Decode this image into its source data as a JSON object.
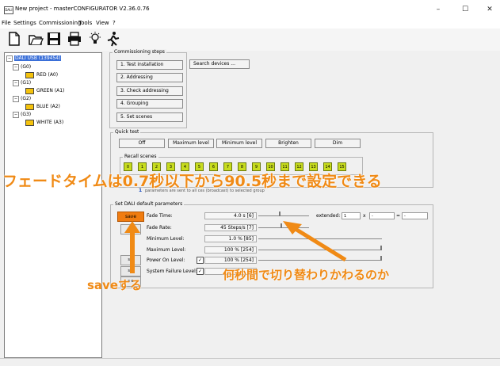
{
  "window": {
    "title": "New project - masterCONFIGURATOR V2.36.0.76",
    "app_icon_text": "DALI",
    "minimize": "–",
    "maximize": "☐",
    "close": "✕"
  },
  "menu": [
    "File",
    "Settings",
    "Commissioning",
    "Tools",
    "View",
    "?"
  ],
  "toolbar_icons": [
    "new-document-icon",
    "open-folder-icon",
    "save-disk-icon",
    "print-icon",
    "lightbulb-icon",
    "running-person-icon"
  ],
  "tree": {
    "root": "DALI USB (139454)",
    "groups": [
      {
        "name": "(G0)",
        "device": "RED (A0)"
      },
      {
        "name": "(G1)",
        "device": "GREEN (A1)"
      },
      {
        "name": "(G2)",
        "device": "BLUE (A2)"
      },
      {
        "name": "(G3)",
        "device": "WHITE (A3)"
      }
    ]
  },
  "commissioning": {
    "title": "Commissioning steps",
    "steps": [
      "1. Test installation",
      "2. Addressing",
      "3. Check addressing",
      "4. Grouping",
      "5. Set scenes"
    ],
    "search": "Search devices ..."
  },
  "quick_test": {
    "title": "Quick test",
    "buttons": [
      "Off",
      "Maximum level",
      "Minimum level",
      "Brighten",
      "Dim"
    ],
    "recall_title": "Recall scenes",
    "scenes": [
      "0",
      "1",
      "2",
      "3",
      "4",
      "5",
      "6",
      "7",
      "8",
      "9",
      "10",
      "11",
      "12",
      "13",
      "14",
      "15"
    ],
    "hint_prefix": "1",
    "hint_text": "parameters are sent to all       ces (broadcast)    to selected group"
  },
  "defaults": {
    "title": "Set DALI default parameters",
    "save": "save",
    "side_buttons": [
      "s e",
      "s e",
      "s e",
      "s e"
    ],
    "rows": [
      {
        "label": "Fade Time:",
        "value": "4.0  s [6]"
      },
      {
        "label": "Fade Rate:",
        "value": "45  Steps/s [7]"
      },
      {
        "label": "Minimum Level:",
        "value": "1.0 % [85]"
      },
      {
        "label": "Maximum Level:",
        "value": "100 % [254]"
      },
      {
        "label": "Power On Level:",
        "value": "100 % [254]"
      },
      {
        "label": "System Failure Level:",
        "value": ""
      }
    ],
    "extended_label": "extended:",
    "extended_val1": "1",
    "extended_x": "x",
    "extended_val2": "-",
    "extended_eq": "=",
    "extended_val3": "-",
    "check": "✓"
  },
  "annotations": {
    "headline": "フェードタイムは0.7秒以下から90.5秒まで設定できる",
    "middle": "何秒間で切り替わりかわるのか",
    "save_note": "saveする"
  },
  "colors": {
    "annotation": "#f08a15",
    "save_button": "#f07c10",
    "scene_button": "#c8dc1e",
    "selection": "#3a6fd8"
  }
}
